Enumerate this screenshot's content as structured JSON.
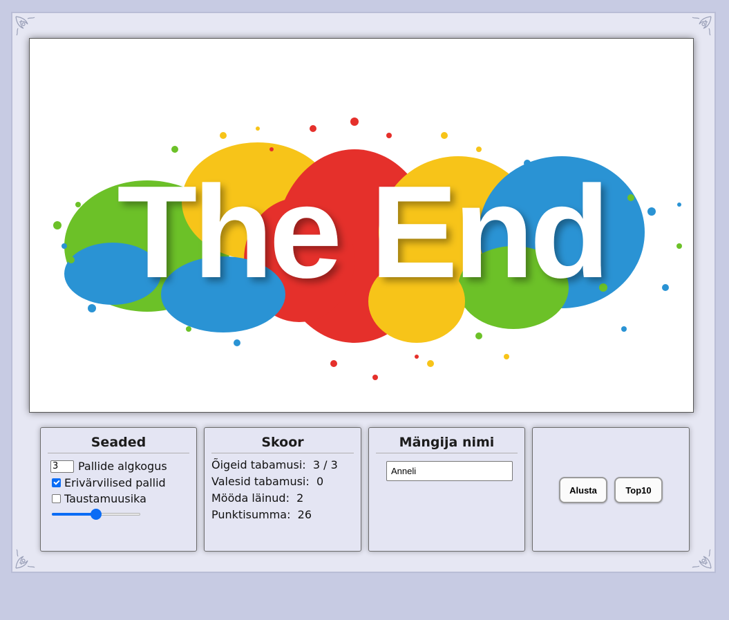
{
  "canvas": {
    "image_text": "The End",
    "splash_colors": [
      "#6cc128",
      "#f7c419",
      "#e5302b",
      "#2a93d4"
    ]
  },
  "settings": {
    "title": "Seaded",
    "ball_count_value": "3",
    "ball_count_label": "Pallide algkogus",
    "colored_balls_label": "Erivärvilised pallid",
    "colored_balls_checked": true,
    "music_label": "Taustamuusika",
    "music_checked": false,
    "volume_fraction": 0.5
  },
  "score": {
    "title": "Skoor",
    "correct_label": "Õigeid tabamusi:",
    "correct_value": "3 / 3",
    "wrong_label": "Valesid tabamusi:",
    "wrong_value": "0",
    "missed_label": "Mööda läinud:",
    "missed_value": "2",
    "total_label": "Punktisumma:",
    "total_value": "26"
  },
  "player": {
    "title": "Mängija nimi",
    "name_value": "Anneli"
  },
  "actions": {
    "start_label": "Alusta",
    "top_label": "Top10"
  },
  "colors": {
    "page_background": "#c7cbe3",
    "panel_background": "#e4e5f3",
    "accent": "#0b6cf5"
  }
}
